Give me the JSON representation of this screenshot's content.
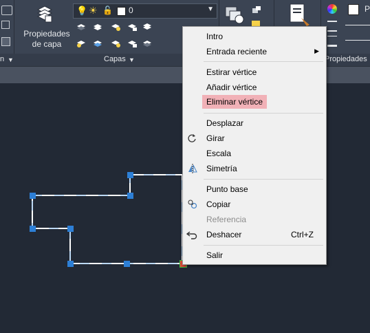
{
  "ribbon": {
    "layer_properties_line1": "Propiedades",
    "layer_properties_line2": "de capa",
    "current_layer": "0",
    "layers_panel_label": "Capas",
    "properties_label_fragment": "Propiedades",
    "left_panel_fragment": "n",
    "right_dropdown_fragment": "P"
  },
  "context_menu": {
    "items": [
      {
        "label": "Intro"
      },
      {
        "label": "Entrada reciente"
      },
      {
        "label": "Estirar vértice"
      },
      {
        "label": "Añadir vértice"
      },
      {
        "label": "Eliminar vértice"
      },
      {
        "label": "Desplazar"
      },
      {
        "label": "Girar"
      },
      {
        "label": "Escala"
      },
      {
        "label": "Simetría"
      },
      {
        "label": "Punto base"
      },
      {
        "label": "Copiar"
      },
      {
        "label": "Referencia"
      },
      {
        "label": "Deshacer",
        "shortcut": "Ctrl+Z"
      },
      {
        "label": "Salir"
      }
    ]
  },
  "colors": {
    "canvas": "#222935",
    "ribbon": "#3b4453",
    "grip": "#2d7fd6",
    "highlight": "#f1b1b7"
  }
}
